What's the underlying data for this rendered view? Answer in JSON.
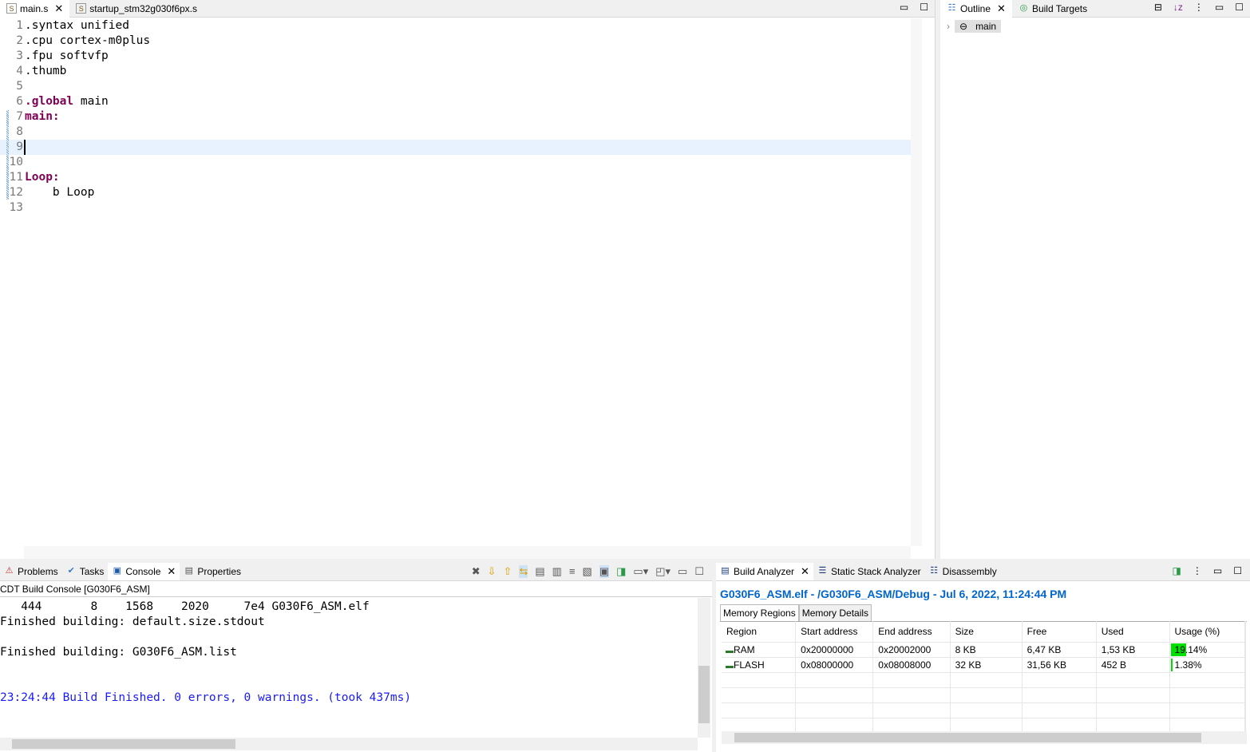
{
  "editor": {
    "tabs": [
      {
        "label": "main.s",
        "active": true
      },
      {
        "label": "startup_stm32g030f6px.s",
        "active": false
      }
    ],
    "lines": [
      {
        "n": "1",
        "parts": [
          {
            "t": ".syntax unified",
            "k": false
          }
        ]
      },
      {
        "n": "2",
        "parts": [
          {
            "t": ".cpu cortex-m0plus",
            "k": false
          }
        ]
      },
      {
        "n": "3",
        "parts": [
          {
            "t": ".fpu softvfp",
            "k": false
          }
        ]
      },
      {
        "n": "4",
        "parts": [
          {
            "t": ".thumb",
            "k": false
          }
        ]
      },
      {
        "n": "5",
        "parts": []
      },
      {
        "n": "6",
        "parts": [
          {
            "t": ".global",
            "k": true
          },
          {
            "t": " main",
            "k": false
          }
        ]
      },
      {
        "n": "7",
        "parts": [
          {
            "t": "main:",
            "k": true
          }
        ]
      },
      {
        "n": "8",
        "parts": []
      },
      {
        "n": "9",
        "parts": [],
        "current": true
      },
      {
        "n": "10",
        "parts": []
      },
      {
        "n": "11",
        "parts": [
          {
            "t": "Loop:",
            "k": true
          }
        ]
      },
      {
        "n": "12",
        "parts": [
          {
            "t": "    b Loop",
            "k": false
          }
        ]
      },
      {
        "n": "13",
        "parts": []
      }
    ]
  },
  "outline": {
    "tabs": [
      "Outline",
      "Build Targets"
    ],
    "items": [
      "main"
    ]
  },
  "console": {
    "tabs": [
      "Problems",
      "Tasks",
      "Console",
      "Properties"
    ],
    "title": "CDT Build Console [G030F6_ASM]",
    "lines": [
      {
        "t": "   444       8    1568    2020     7e4 G030F6_ASM.elf",
        "c": "#000"
      },
      {
        "t": "Finished building: default.size.stdout",
        "c": "#000"
      },
      {
        "t": "",
        "c": "#000"
      },
      {
        "t": "Finished building: G030F6_ASM.list",
        "c": "#000"
      },
      {
        "t": "",
        "c": "#000"
      },
      {
        "t": "",
        "c": "#000"
      },
      {
        "t": "23:24:44 Build Finished. 0 errors, 0 warnings. (took 437ms)",
        "c": "#1a1aff"
      }
    ]
  },
  "build_analyzer": {
    "tabs": [
      "Build Analyzer",
      "Static Stack Analyzer",
      "Disassembly"
    ],
    "title": "G030F6_ASM.elf - /G030F6_ASM/Debug - Jul 6, 2022, 11:24:44 PM",
    "subtabs": [
      "Memory Regions",
      "Memory Details"
    ],
    "columns": [
      "Region",
      "Start address",
      "End address",
      "Size",
      "Free",
      "Used",
      "Usage (%)"
    ],
    "rows": [
      {
        "cells": [
          "RAM",
          "0x20000000",
          "0x20002000",
          "8 KB",
          "6,47 KB",
          "1,53 KB",
          "19.14%"
        ],
        "usage": 19.14
      },
      {
        "cells": [
          "FLASH",
          "0x08000000",
          "0x08008000",
          "32 KB",
          "31,56 KB",
          "452 B",
          "1.38%"
        ],
        "usage": 1.38
      }
    ]
  },
  "colors": {
    "accent": "#0066cc",
    "keyword": "#7f0055",
    "usage_bar": "#00e000",
    "current_line": "#e8f2fe"
  }
}
